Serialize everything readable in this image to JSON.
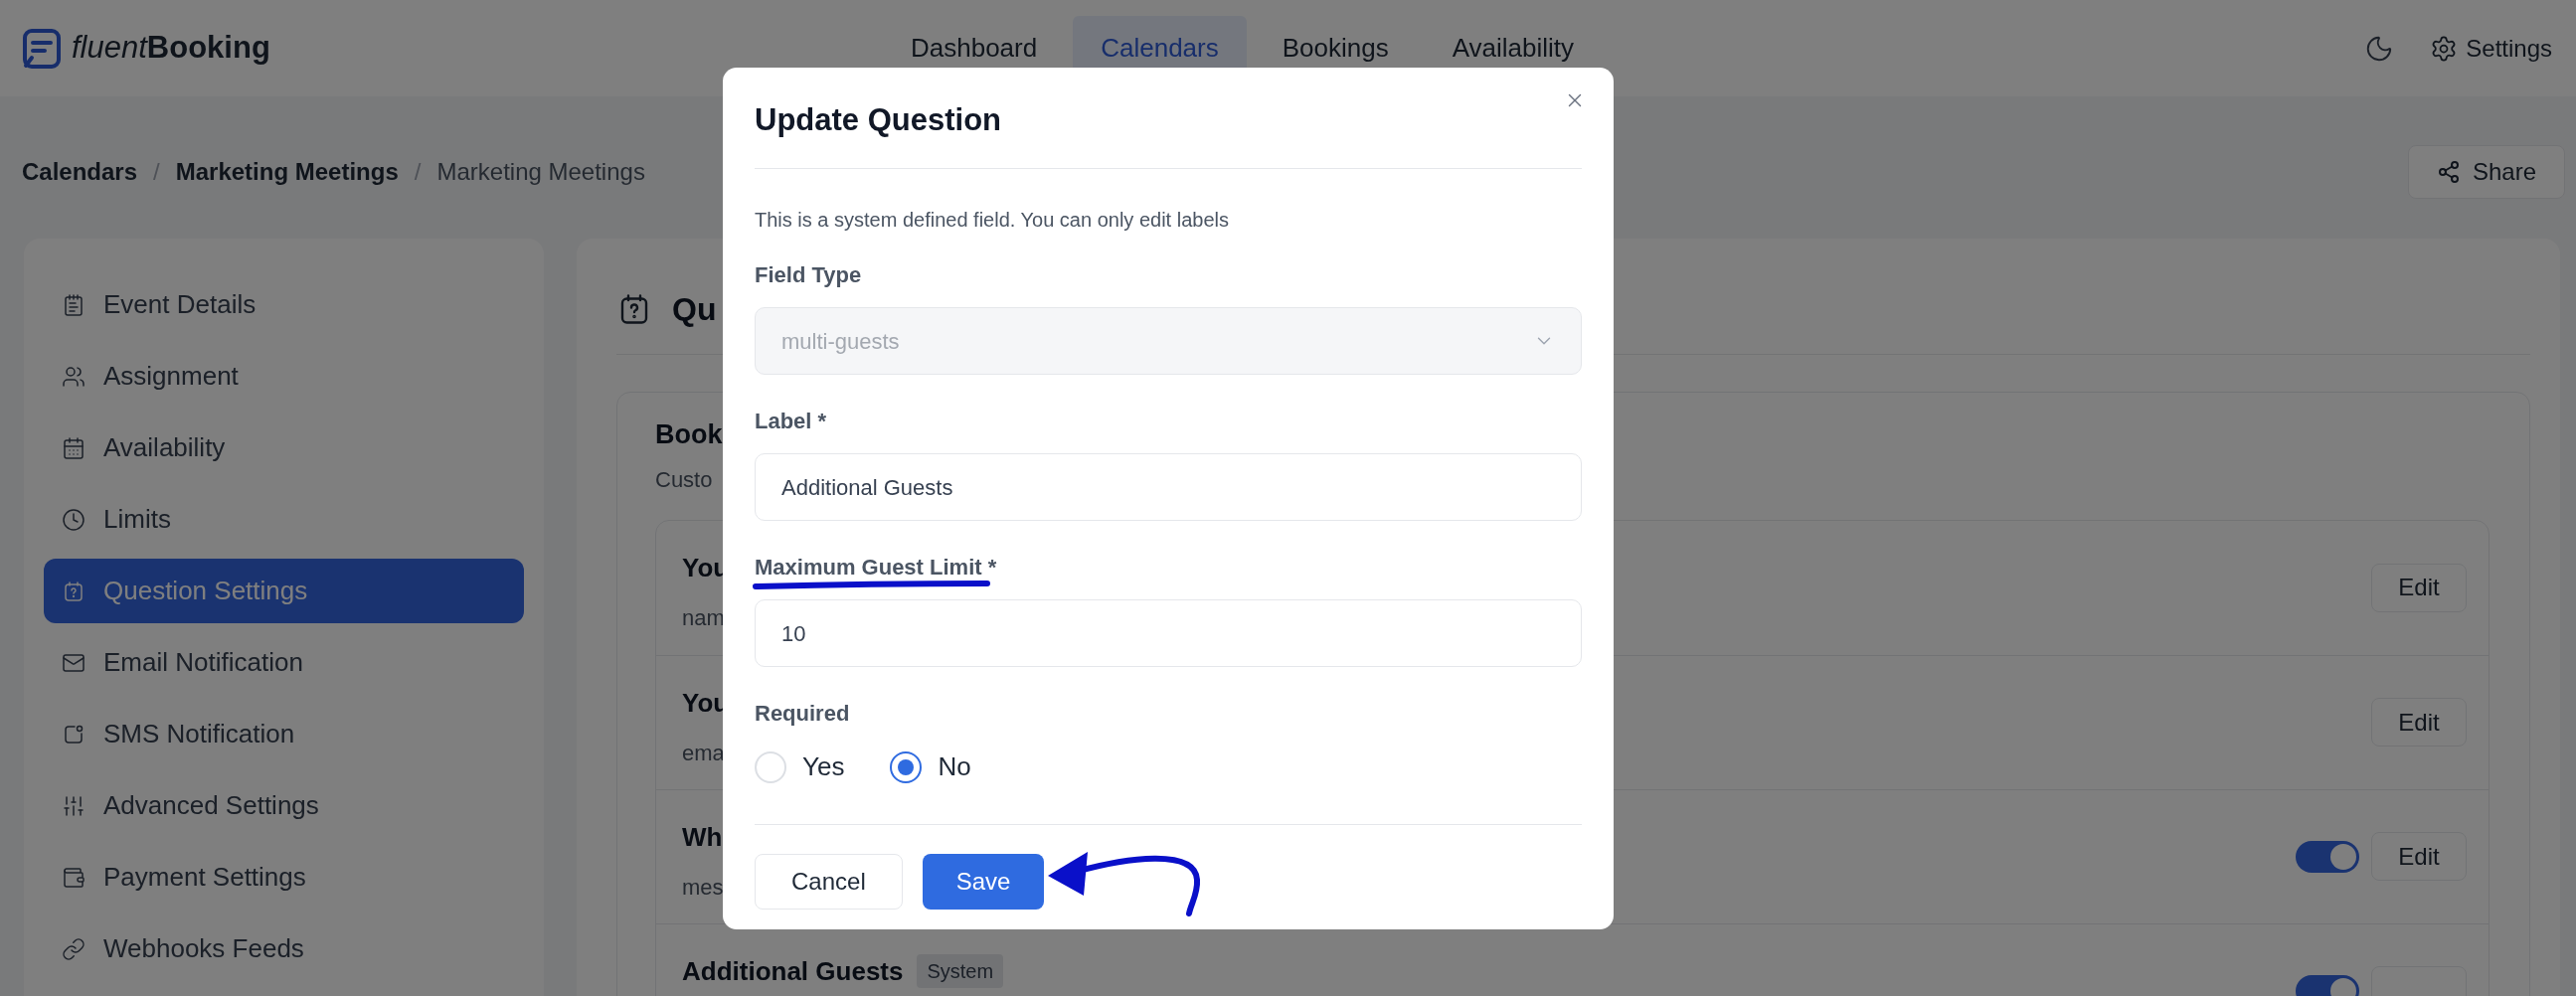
{
  "header": {
    "logo": {
      "light": "fluent",
      "bold": "Booking"
    },
    "nav": [
      {
        "label": "Dashboard",
        "selected": false
      },
      {
        "label": "Calendars",
        "selected": true
      },
      {
        "label": "Bookings",
        "selected": false
      },
      {
        "label": "Availability",
        "selected": false
      }
    ],
    "settings_label": "Settings"
  },
  "breadcrumb": [
    {
      "label": "Calendars",
      "kind": "link"
    },
    {
      "label": "/",
      "kind": "separator"
    },
    {
      "label": "Marketing Meetings",
      "kind": "link"
    },
    {
      "label": "/",
      "kind": "separator"
    },
    {
      "label": "Marketing Meetings",
      "kind": "current"
    }
  ],
  "share_label": "Share",
  "sidebar": {
    "items": [
      {
        "label": "Event Details",
        "selected": false
      },
      {
        "label": "Assignment",
        "selected": false
      },
      {
        "label": "Availability",
        "selected": false
      },
      {
        "label": "Limits",
        "selected": false
      },
      {
        "label": "Question Settings",
        "selected": true
      },
      {
        "label": "Email Notification",
        "selected": false
      },
      {
        "label": "SMS Notification",
        "selected": false
      },
      {
        "label": "Advanced Settings",
        "selected": false
      },
      {
        "label": "Payment Settings",
        "selected": false
      },
      {
        "label": "Webhooks Feeds",
        "selected": false
      }
    ]
  },
  "main": {
    "title": "Qu",
    "section_title": "Book",
    "section_subtitle": "Custo",
    "questions": [
      {
        "kind": "plain",
        "title": "You",
        "subtitle": "nam",
        "edit_label": "Edit"
      },
      {
        "kind": "plain",
        "title": "You",
        "subtitle": "ema",
        "edit_label": "Edit"
      },
      {
        "kind": "toggle",
        "title": "Wh",
        "subtitle": "mes",
        "on": true,
        "edit_label": "Edit"
      },
      {
        "kind": "toggle",
        "title": "Additional Guests",
        "badge": "System",
        "on": true
      }
    ]
  },
  "modal": {
    "title": "Update Question",
    "note": "This is a system defined field. You can only edit labels",
    "fields": [
      {
        "kind": "select",
        "label": "Field Type",
        "value": "multi-guests",
        "disabled": true,
        "annotated": false
      },
      {
        "kind": "text",
        "label": "Label *",
        "value": "Additional Guests",
        "annotated": false
      },
      {
        "kind": "text",
        "label": "Maximum Guest Limit *",
        "value": "10",
        "annotated": true
      },
      {
        "kind": "radio",
        "label": "Required",
        "annotated": false,
        "options": [
          {
            "label": "Yes",
            "selected": false
          },
          {
            "label": "No",
            "selected": true
          }
        ]
      }
    ],
    "buttons": [
      {
        "label": "Cancel",
        "kind": "secondary",
        "annotated": false
      },
      {
        "label": "Save",
        "kind": "primary",
        "annotated": true
      }
    ]
  }
}
